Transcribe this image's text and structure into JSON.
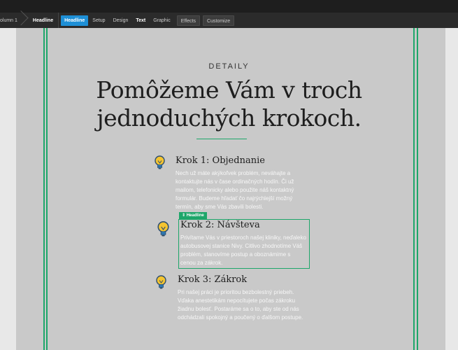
{
  "toolbar": {
    "crumbs": [
      "olumn 1",
      "Headline"
    ],
    "tabs": {
      "headline": "Headline",
      "setup": "Setup",
      "design": "Design",
      "text": "Text",
      "graphic": "Graphic",
      "effects": "Effects",
      "customize": "Customize"
    }
  },
  "section": {
    "eyebrow": "DETAILY",
    "headline_line1": "Pomôžeme Vám v troch",
    "headline_line2": "jednoduchých krokoch."
  },
  "steps": [
    {
      "title": "Krok 1: Objednanie",
      "lines": [
        "Nech už máte akýkoľvek problém, neváhajte a",
        "kontaktujte nás v čase ordinačných hodín. Či už",
        "mailom, telefonicky alebo použite náš kontaktný",
        "formulár. Budeme hľadať čo najrýchlejší možný",
        "termín, aby sme Vás zbavili bolesti."
      ]
    },
    {
      "title": "Krok 2: Návšteva",
      "lines": [
        "Privítame Vás v priestoroch našej kliniky, neďaleko",
        "autobusovej stanice Nivy. Citlivo zhodnotíme Váš",
        "problém, stanovíme postup a oboznámime s",
        "cenou za zákrok."
      ]
    },
    {
      "title": "Krok 3: Zákrok",
      "lines": [
        "Pri našej práci je prioritou bezbolestný priebeh.",
        "Vďaka anestetikám nepocítujete počas zákroku",
        "žiadnu bolesť. Postaráme sa o to, aby ste od nás",
        "odchádzali spokojný a poučený o ďalšom postupe."
      ]
    }
  ],
  "selection": {
    "tag": "Headline"
  },
  "colors": {
    "accent": "#1ea66a",
    "active_tab": "#1e8fd6",
    "canvas": "#c9c9c9"
  },
  "icons": {
    "step": "lightbulb-icon"
  }
}
